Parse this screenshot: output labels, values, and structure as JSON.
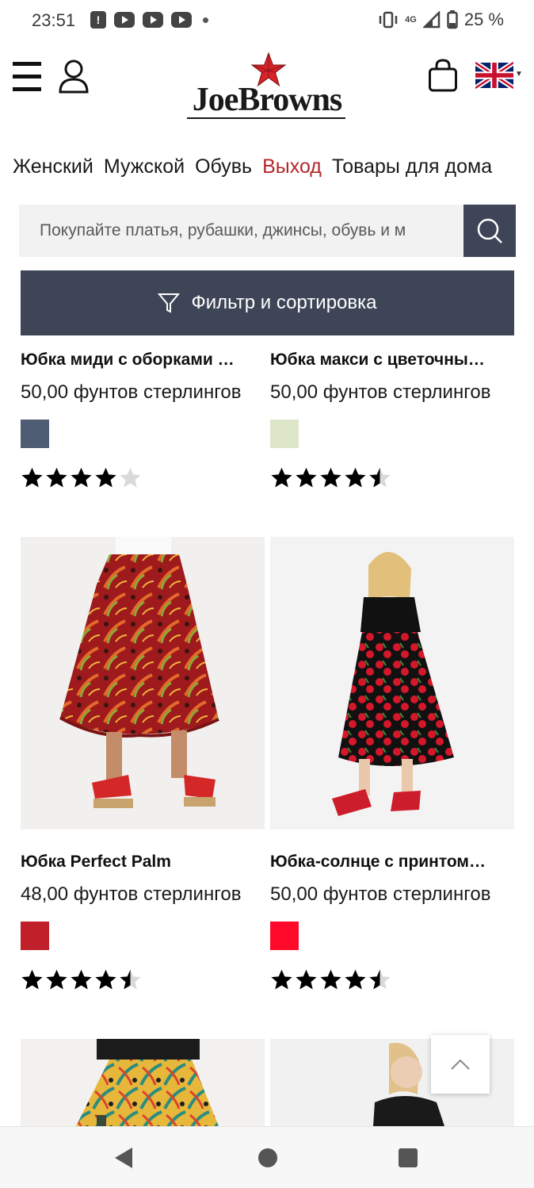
{
  "status_bar": {
    "time": "23:51",
    "notification_icons": [
      "message-icon",
      "youtube-icon",
      "youtube-icon",
      "youtube-icon"
    ],
    "network": "4G",
    "battery": "25 %"
  },
  "header": {
    "logo_text": "JoeBrowns",
    "colors": {
      "brand_red": "#d8232a",
      "brand_dark": "#1a1a1a"
    }
  },
  "nav": {
    "items": [
      {
        "label": "Женский"
      },
      {
        "label": "Мужской"
      },
      {
        "label": "Обувь"
      },
      {
        "label": "Выход",
        "active": true
      },
      {
        "label": "Товары для дома"
      }
    ]
  },
  "search": {
    "placeholder": "Покупайте платья, рубашки, джинсы, обувь и м"
  },
  "filter": {
    "label": "Фильтр и сортировка"
  },
  "products": [
    {
      "title": "Юбка миди с оборками …",
      "price": "50,00 фунтов стерлингов",
      "swatch": "#4e5d73",
      "rating": 4.0
    },
    {
      "title": "Юбка макси с цветочны…",
      "price": "50,00 фунтов стерлингов",
      "swatch": "#dde6c8",
      "rating": 4.5
    },
    {
      "title": "Юбка Perfect Palm",
      "price": "48,00 фунтов стерлингов",
      "swatch": "#c0202a",
      "rating": 4.5
    },
    {
      "title": "Юбка-солнце с принтом…",
      "price": "50,00 фунтов стерлингов",
      "swatch": "#ff0a2a",
      "rating": 4.5
    }
  ],
  "colors": {
    "accent_navy": "#3d4557",
    "nav_active": "#b3272b"
  }
}
